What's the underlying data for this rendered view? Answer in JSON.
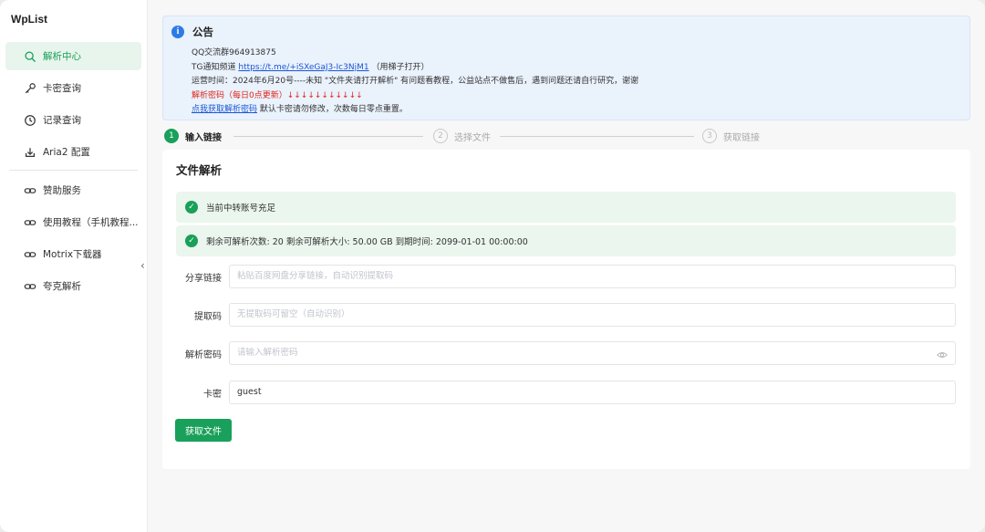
{
  "sidebar": {
    "brand": "WpList",
    "items": [
      {
        "label": "解析中心",
        "icon": "search-icon",
        "active": true
      },
      {
        "label": "卡密查询",
        "icon": "key-icon"
      },
      {
        "label": "记录查询",
        "icon": "clock-icon"
      },
      {
        "label": "Aria2 配置",
        "icon": "download-icon"
      },
      {
        "label": "赞助服务",
        "icon": "link-icon"
      },
      {
        "label": "使用教程（手机教程...",
        "icon": "link-icon"
      },
      {
        "label": "Motrix下载器",
        "icon": "link-icon"
      },
      {
        "label": "夸克解析",
        "icon": "link-icon"
      }
    ],
    "collapse_glyph": "‹"
  },
  "notice": {
    "title": "公告",
    "line1": "QQ交流群964913875",
    "line2_prefix": "TG通知频道",
    "line2_link": "https://t.me/+iSXeGaJ3-Ic3NjM1",
    "line2_suffix": "（用梯子打开）",
    "line3": "运营时间：2024年6月20号----未知 \"文件夹请打开解析\" 有问题看教程，公益站点不做售后，遇到问题还请自行研究，谢谢",
    "line4": "解析密码（每日0点更新）↓↓↓↓↓↓↓↓↓↓↓",
    "line5_link": "点我获取解析密码",
    "line5_suffix": " 默认卡密请勿修改，次数每日零点重置。"
  },
  "steps": [
    {
      "num": "1",
      "label": "输入链接",
      "done": true
    },
    {
      "num": "2",
      "label": "选择文件",
      "done": false
    },
    {
      "num": "3",
      "label": "获取链接",
      "done": false
    }
  ],
  "form": {
    "title": "文件解析",
    "alert1": "当前中转账号充足",
    "alert2": "剩余可解析次数: 20   剩余可解析大小: 50.00 GB   到期时间: 2099-01-01 00:00:00",
    "share_label": "分享链接",
    "share_placeholder": "粘贴百度网盘分享链接，自动识别提取码",
    "code_label": "提取码",
    "code_placeholder": "无提取码可留空（自动识别）",
    "pwd_label": "解析密码",
    "pwd_placeholder": "请输入解析密码",
    "card_label": "卡密",
    "card_value": "guest",
    "submit_label": "获取文件"
  },
  "colors": {
    "accent": "#19a05a",
    "notice_bg": "#eaf2fc",
    "danger": "#e0251c",
    "link": "#1a56d6"
  }
}
